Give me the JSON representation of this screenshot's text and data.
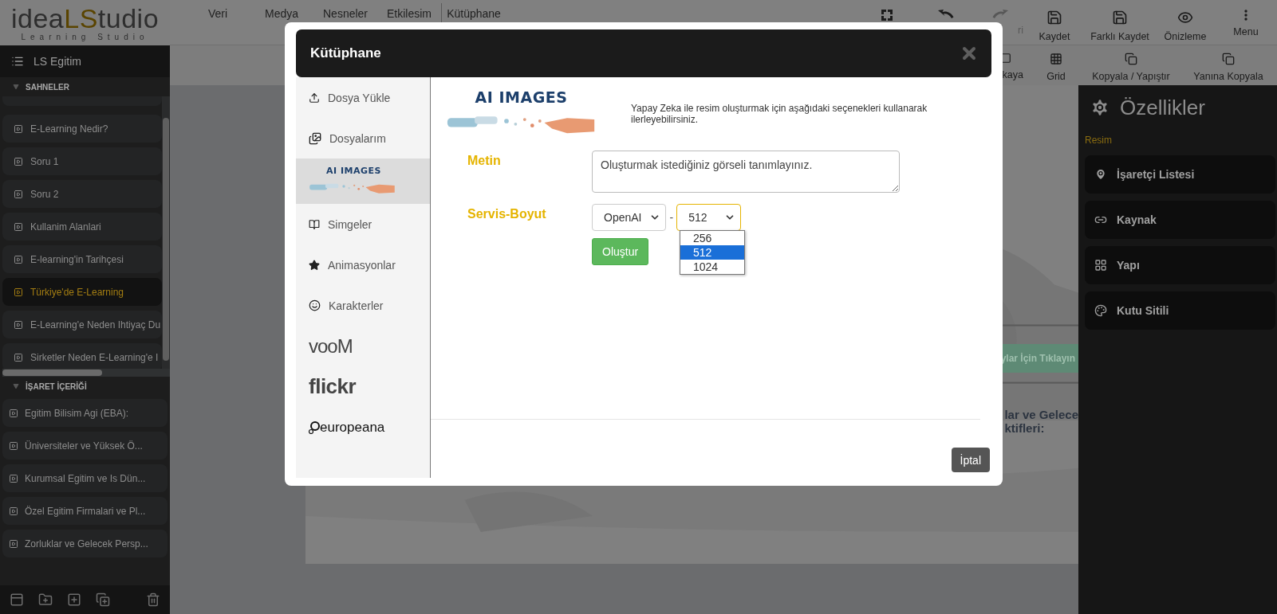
{
  "logo": {
    "part_a": "idea",
    "part_b": "LS",
    "part_c": "tudio",
    "tagline": "Learning Studio"
  },
  "top_menu": [
    {
      "label": "Veri",
      "divider": false
    },
    {
      "label": "Medya",
      "divider": false
    },
    {
      "label": "Nesneler",
      "divider": false
    },
    {
      "label": "Etkilesim",
      "divider": true
    },
    {
      "label": "Kütüphane",
      "divider": false
    }
  ],
  "toolbar": [
    {
      "kind": "fullscreen",
      "disabled": false
    },
    {
      "kind": "undo",
      "disabled": false
    },
    {
      "kind": "redo",
      "label": "ri",
      "disabled": true
    },
    {
      "kind": "save",
      "label": "Kaydet",
      "disabled": false
    },
    {
      "kind": "save",
      "label": "Farklı Kaydet",
      "disabled": false
    },
    {
      "kind": "preview",
      "label": "Önizleme",
      "disabled": false
    },
    {
      "kind": "menu",
      "label": "Menu",
      "disabled": false
    }
  ],
  "toolbar_2": [
    {
      "kind": "tool",
      "label": "kaya"
    },
    {
      "kind": "grid",
      "label": "Grid"
    },
    {
      "kind": "copy",
      "label": "Kopyala / Yapıştır"
    },
    {
      "kind": "copy",
      "label": "Yanına Kopyala"
    }
  ],
  "project": {
    "title": "LS Egitim"
  },
  "scenes": {
    "title": "SAHNELER",
    "items": [
      {
        "label": "E-Learning Nedir?",
        "selected": false
      },
      {
        "label": "Soru 1",
        "selected": false
      },
      {
        "label": "Soru 2",
        "selected": false
      },
      {
        "label": "Kullanim Alanlari",
        "selected": false
      },
      {
        "label": "E-learning'in Tarihçesi",
        "selected": false
      },
      {
        "label": "Türkiye'de E-Learning",
        "selected": true
      },
      {
        "label": "E-Learning'e Neden Ihtiyaç Du",
        "selected": false
      },
      {
        "label": "Sirketler Neden E-Learning'e I",
        "selected": false
      }
    ]
  },
  "markers": {
    "title": "İŞARET İÇERİĞİ",
    "items": [
      {
        "label": "Egitim Bilisim Agi (EBA):"
      },
      {
        "label": "Üniversiteler ve Yüksek Ö..."
      },
      {
        "label": "Kurumsal Egitim ve Is Dün..."
      },
      {
        "label": "Özel Egitim Firmalari ve Pl..."
      },
      {
        "label": "Zorluklar ve Gelecek Persp..."
      }
    ]
  },
  "slide": {
    "kind": "picture",
    "button": "ylar İçin Tıklayın",
    "heading_lines": [
      "lar ve Gelece",
      "ktifleri:"
    ]
  },
  "properties": {
    "title": "Özellikler",
    "section": "Resim",
    "items": [
      {
        "kind": "marker",
        "label": "İşaretçi Listesi"
      },
      {
        "kind": "link",
        "label": "Kaynak"
      },
      {
        "kind": "grid",
        "label": "Yapı"
      },
      {
        "kind": "palette",
        "label": "Kutu Sitili"
      }
    ]
  },
  "dialog": {
    "title": "Kütüphane",
    "nav": [
      {
        "kind": "upload",
        "label": "Dosya Yükle",
        "selected": false
      },
      {
        "kind": "files",
        "label": "Dosyalarım",
        "selected": false
      },
      {
        "kind": "ai",
        "label": "AI IMAGES",
        "selected": true
      },
      {
        "kind": "symbols",
        "label": "Simgeler",
        "selected": false
      },
      {
        "kind": "animations",
        "label": "Animasyonlar",
        "selected": false
      },
      {
        "kind": "characters",
        "label": "Karakterler",
        "selected": false
      },
      {
        "kind": "voom",
        "label": "vooM",
        "selected": false
      },
      {
        "kind": "flickr",
        "label": "flickr",
        "selected": false
      },
      {
        "kind": "europeana",
        "label": "europeana",
        "selected": false
      }
    ],
    "banner": "AI IMAGES",
    "intro": "Yapay Zeka ile resim oluşturmak için aşağıdaki seçenekleri kullanarak ilerleyebilirsiniz.",
    "text_label": "Metin",
    "text_placeholder": "Oluşturmak istediğiniz görseli tanımlayınız.",
    "service_label": "Servis-Boyut",
    "service": "OpenAI",
    "separator": "-",
    "size": "512",
    "size_options": [
      {
        "label": "256",
        "selected": false
      },
      {
        "label": "512",
        "selected": true
      },
      {
        "label": "1024",
        "selected": false
      }
    ],
    "create_button": "Oluştur",
    "cancel_button": "İptal"
  }
}
